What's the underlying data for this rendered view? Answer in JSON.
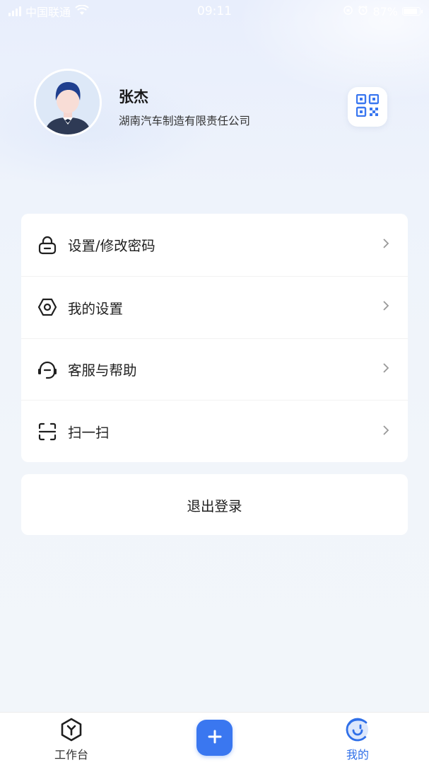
{
  "status_bar": {
    "carrier": "中国联通",
    "time": "09:11",
    "battery": "87%"
  },
  "profile": {
    "name": "张杰",
    "company": "湖南汽车制造有限责任公司"
  },
  "menu": {
    "items": [
      {
        "label": "设置/修改密码",
        "icon": "lock-icon"
      },
      {
        "label": "我的设置",
        "icon": "settings-hex-icon"
      },
      {
        "label": "客服与帮助",
        "icon": "headset-icon"
      },
      {
        "label": "扫一扫",
        "icon": "scan-icon"
      }
    ]
  },
  "logout": {
    "label": "退出登录"
  },
  "tabbar": {
    "tabs": [
      {
        "label": "工作台",
        "icon": "workbench-icon",
        "active": false
      },
      {
        "label": "",
        "icon": "plus-icon",
        "active": false
      },
      {
        "label": "我的",
        "icon": "profile-tab-icon",
        "active": true
      }
    ]
  },
  "colors": {
    "accent": "#3a77f0",
    "active_tab_text": "#2f6fe8",
    "background": "#f1f5fa"
  }
}
